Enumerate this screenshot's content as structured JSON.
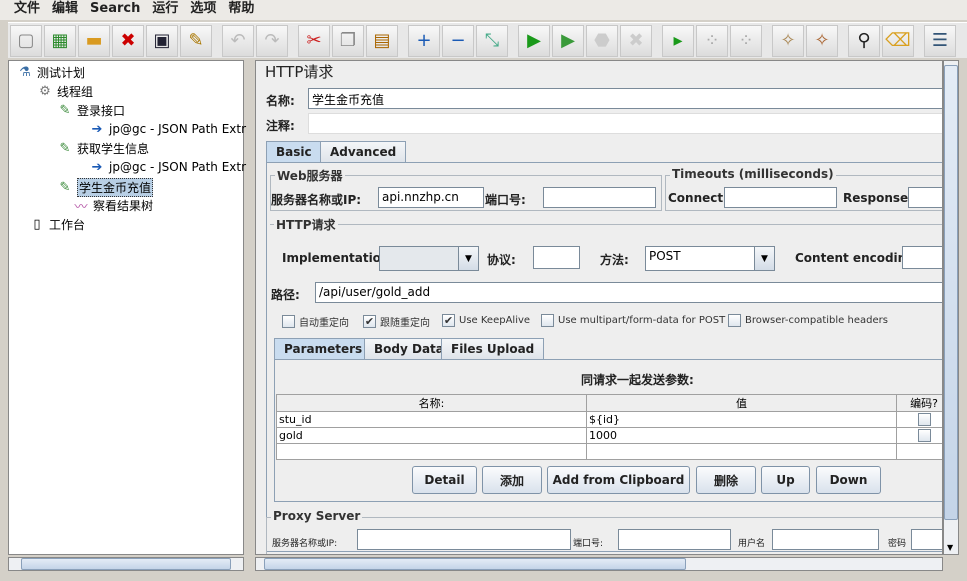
{
  "menu": [
    "文件",
    "编辑",
    "Search",
    "运行",
    "选项",
    "帮助"
  ],
  "toolbar": [
    "new-icon",
    "templates-icon",
    "open-icon",
    "close-icon",
    "save-icon",
    "save-as-icon",
    "undo-icon",
    "redo-icon",
    "cut-icon",
    "copy-icon",
    "paste-icon",
    "expand-icon",
    "collapse-icon",
    "toggle-icon",
    "start-icon",
    "start-no-pause-icon",
    "stop-icon",
    "shutdown-icon",
    "remote-start-icon",
    "remote-stop-icon",
    "remote-exit-icon",
    "clear-icon",
    "clear-all-icon",
    "search-icon",
    "reset-search-icon",
    "function-helper-icon"
  ],
  "tree": {
    "test_plan": "测试计划",
    "thread_group": "线程组",
    "sampler1": "登录接口",
    "extractor1": "jp@gc - JSON Path Extr",
    "sampler2": "获取学生信息",
    "extractor2": "jp@gc - JSON Path Extr",
    "sampler3": "学生金币充值",
    "listener": "察看结果树",
    "workbench": "工作台"
  },
  "panel": {
    "title": "HTTP请求",
    "name_label": "名称:",
    "name_value": "学生金币充值",
    "comment_label": "注释:",
    "comment_value": "",
    "tabs": [
      "Basic",
      "Advanced"
    ],
    "web_server": {
      "title": "Web服务器",
      "server_label": "服务器名称或IP:",
      "server_value": "api.nnzhp.cn",
      "port_label": "端口号:",
      "port_value": ""
    },
    "timeouts": {
      "title": "Timeouts (milliseconds)",
      "connect_label": "Connect:",
      "response_label": "Response:"
    },
    "http": {
      "title": "HTTP请求",
      "impl_label": "Implementation:",
      "impl_value": "",
      "protocol_label": "协议:",
      "protocol_value": "",
      "method_label": "方法:",
      "method_value": "POST",
      "encoding_label": "Content encoding:",
      "path_label": "路径:",
      "path_value": "/api/user/gold_add"
    },
    "checkboxes": [
      {
        "label": "自动重定向",
        "checked": false
      },
      {
        "label": "跟随重定向",
        "checked": true
      },
      {
        "label": "Use KeepAlive",
        "checked": true
      },
      {
        "label": "Use multipart/form-data for POST",
        "checked": false
      },
      {
        "label": "Browser-compatible headers",
        "checked": false
      }
    ],
    "subtabs": [
      "Parameters",
      "Body Data",
      "Files Upload"
    ],
    "params": {
      "caption": "同请求一起发送参数:",
      "headers": [
        "名称:",
        "值",
        "编码?"
      ],
      "rows": [
        {
          "name": "stu_id",
          "value": "${id}",
          "encode": false
        },
        {
          "name": "gold",
          "value": "1000",
          "encode": false
        }
      ]
    },
    "buttons": [
      "Detail",
      "添加",
      "Add from Clipboard",
      "删除",
      "Up",
      "Down"
    ],
    "proxy": {
      "title": "Proxy Server",
      "server_label": "服务器名称或IP:",
      "port_label": "端口号:",
      "user_label": "用户名",
      "password_label": "密码"
    }
  }
}
